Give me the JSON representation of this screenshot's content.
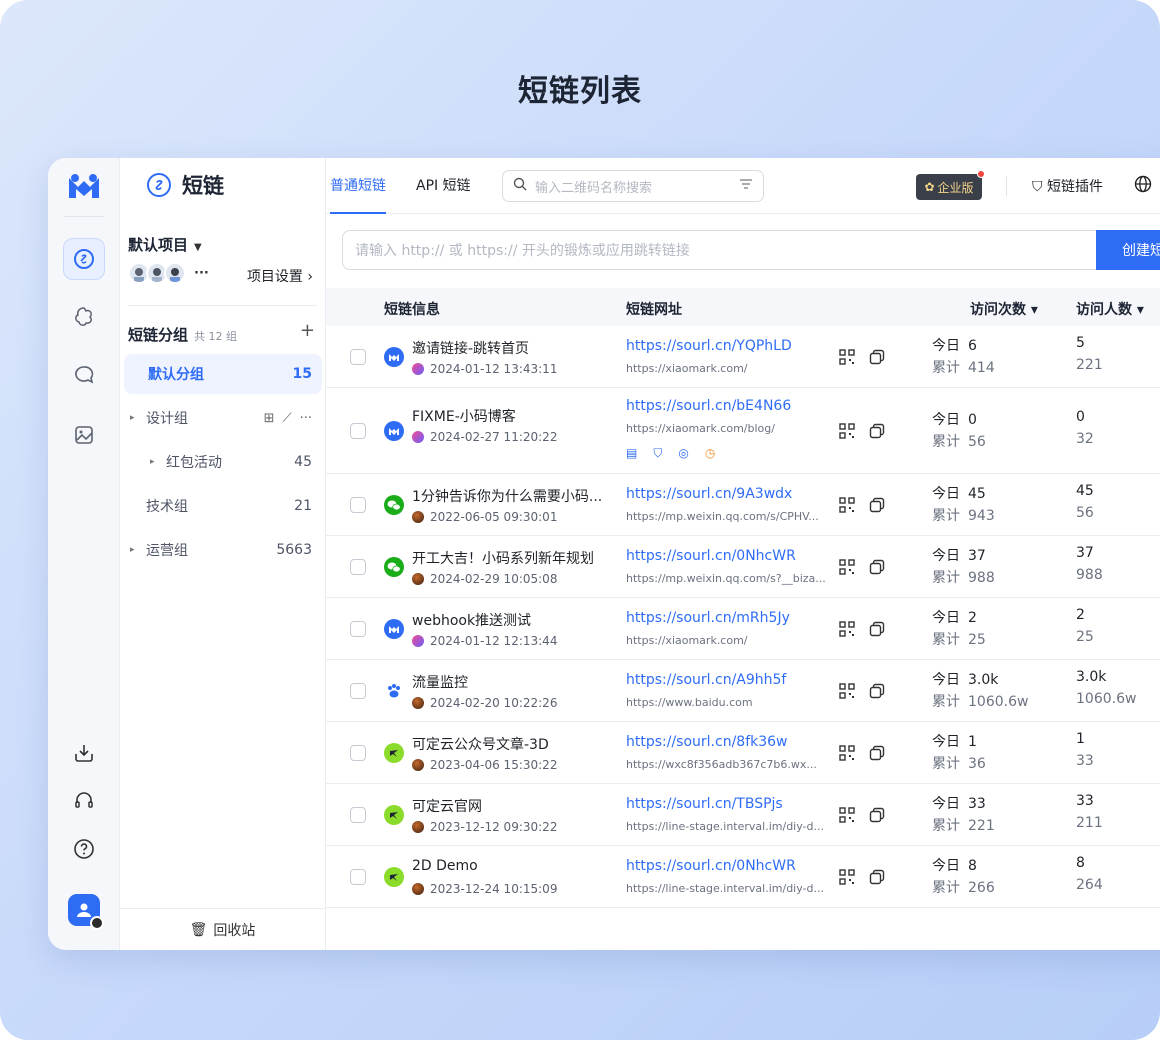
{
  "hero_title": "短链列表",
  "rail": {
    "items": [
      "short-link-icon",
      "ai-icon",
      "chat-icon",
      "image-icon",
      "download-icon",
      "support-icon",
      "help-icon"
    ]
  },
  "brand": {
    "name": "短链"
  },
  "project": {
    "name": "默认项目",
    "more": "···",
    "settings_label": "项目设置 ›"
  },
  "groups": {
    "title": "短链分组",
    "total": "共 12 组",
    "add": "+",
    "items": [
      {
        "name": "默认分组",
        "count": "15",
        "expand": ""
      },
      {
        "name": "设计组",
        "count": "",
        "expand": "▸"
      },
      {
        "name": "红包活动",
        "count": "45",
        "expand": "▸"
      },
      {
        "name": "技术组",
        "count": "21",
        "expand": ""
      },
      {
        "name": "运营组",
        "count": "5663",
        "expand": "▸"
      }
    ],
    "trash_label": "回收站"
  },
  "topbar": {
    "tabs": [
      "普通短链",
      "API 短链"
    ],
    "search_placeholder": "输入二维码名称搜索",
    "enterprise_badge": "企业版",
    "plugin_label": "短链插件"
  },
  "url_input": {
    "placeholder": "请输入 http:// 或 https:// 开头的锻炼或应用跳转链接",
    "create_label": "创建短链"
  },
  "table": {
    "headers": {
      "info": "短链信息",
      "url": "短链网址",
      "visits": "访问次数 ▾",
      "visitors": "访问人数 ▾"
    },
    "today_label": "今日",
    "total_label": "累计",
    "rows": [
      {
        "name": "邀请链接-跳转首页",
        "date": "2024-01-12 13:43:11",
        "short": "https://sourl.cn/YQPhLD",
        "orig": "https://xiaomark.com/",
        "today_visits": "6",
        "total_visits": "414",
        "today_visitors": "5",
        "total_visitors": "221",
        "icon": "xiaomark",
        "date_icon": "gradient"
      },
      {
        "name": "FIXME-小码博客",
        "date": "2024-02-27 11:20:22",
        "short": "https://sourl.cn/bE4N66",
        "orig": "https://xiaomark.com/blog/",
        "today_visits": "0",
        "total_visits": "56",
        "today_visitors": "0",
        "total_visitors": "32",
        "icon": "xiaomark",
        "date_icon": "gradient"
      },
      {
        "name": "1分钟告诉你为什么需要小码...",
        "date": "2022-06-05 09:30:01",
        "short": "https://sourl.cn/9A3wdx",
        "orig": "https://mp.weixin.qq.com/s/CPHV...",
        "today_visits": "45",
        "total_visits": "943",
        "today_visitors": "45",
        "total_visitors": "56",
        "icon": "wechat",
        "date_icon": "avatar"
      },
      {
        "name": "开工大吉！小码系列新年规划",
        "date": "2024-02-29 10:05:08",
        "short": "https://sourl.cn/0NhcWR",
        "orig": "https://mp.weixin.qq.com/s?__biza...",
        "today_visits": "37",
        "total_visits": "988",
        "today_visitors": "37",
        "total_visitors": "988",
        "icon": "wechat",
        "date_icon": "avatar"
      },
      {
        "name": "webhook推送测试",
        "date": "2024-01-12 12:13:44",
        "short": "https://sourl.cn/mRh5Jy",
        "orig": "https://xiaomark.com/",
        "today_visits": "2",
        "total_visits": "25",
        "today_visitors": "2",
        "total_visitors": "25",
        "icon": "xiaomark",
        "date_icon": "gradient"
      },
      {
        "name": "流量监控",
        "date": "2024-02-20 10:22:26",
        "short": "https://sourl.cn/A9hh5f",
        "orig": "https://www.baidu.com",
        "today_visits": "3.0k",
        "total_visits": "1060.6w",
        "today_visitors": "3.0k",
        "total_visitors": "1060.6w",
        "icon": "baidu",
        "date_icon": "avatar"
      },
      {
        "name": "可定云公众号文章-3D",
        "date": "2023-04-06 15:30:22",
        "short": "https://sourl.cn/8fk36w",
        "orig": "https://wxc8f356adb367c7b6.wx...",
        "today_visits": "1",
        "total_visits": "36",
        "today_visitors": "1",
        "total_visitors": "33",
        "icon": "kedingyun",
        "date_icon": "avatar"
      },
      {
        "name": "可定云官网",
        "date": "2023-12-12 09:30:22",
        "short": "https://sourl.cn/TBSPjs",
        "orig": "https://line-stage.interval.im/diy-d...",
        "today_visits": "33",
        "total_visits": "221",
        "today_visitors": "33",
        "total_visitors": "211",
        "icon": "kedingyun",
        "date_icon": "avatar"
      },
      {
        "name": "2D Demo",
        "date": "2023-12-24 10:15:09",
        "short": "https://sourl.cn/0NhcWR",
        "orig": "https://line-stage.interval.im/diy-d...",
        "today_visits": "8",
        "total_visits": "266",
        "today_visitors": "8",
        "total_visitors": "264",
        "icon": "kedingyun",
        "date_icon": "avatar"
      }
    ]
  },
  "colors": {
    "accent": "#2f6cf6",
    "wechat": "#1aad19",
    "kedingyun": "#8bdc2a",
    "baidu": "#2f6cf6"
  }
}
